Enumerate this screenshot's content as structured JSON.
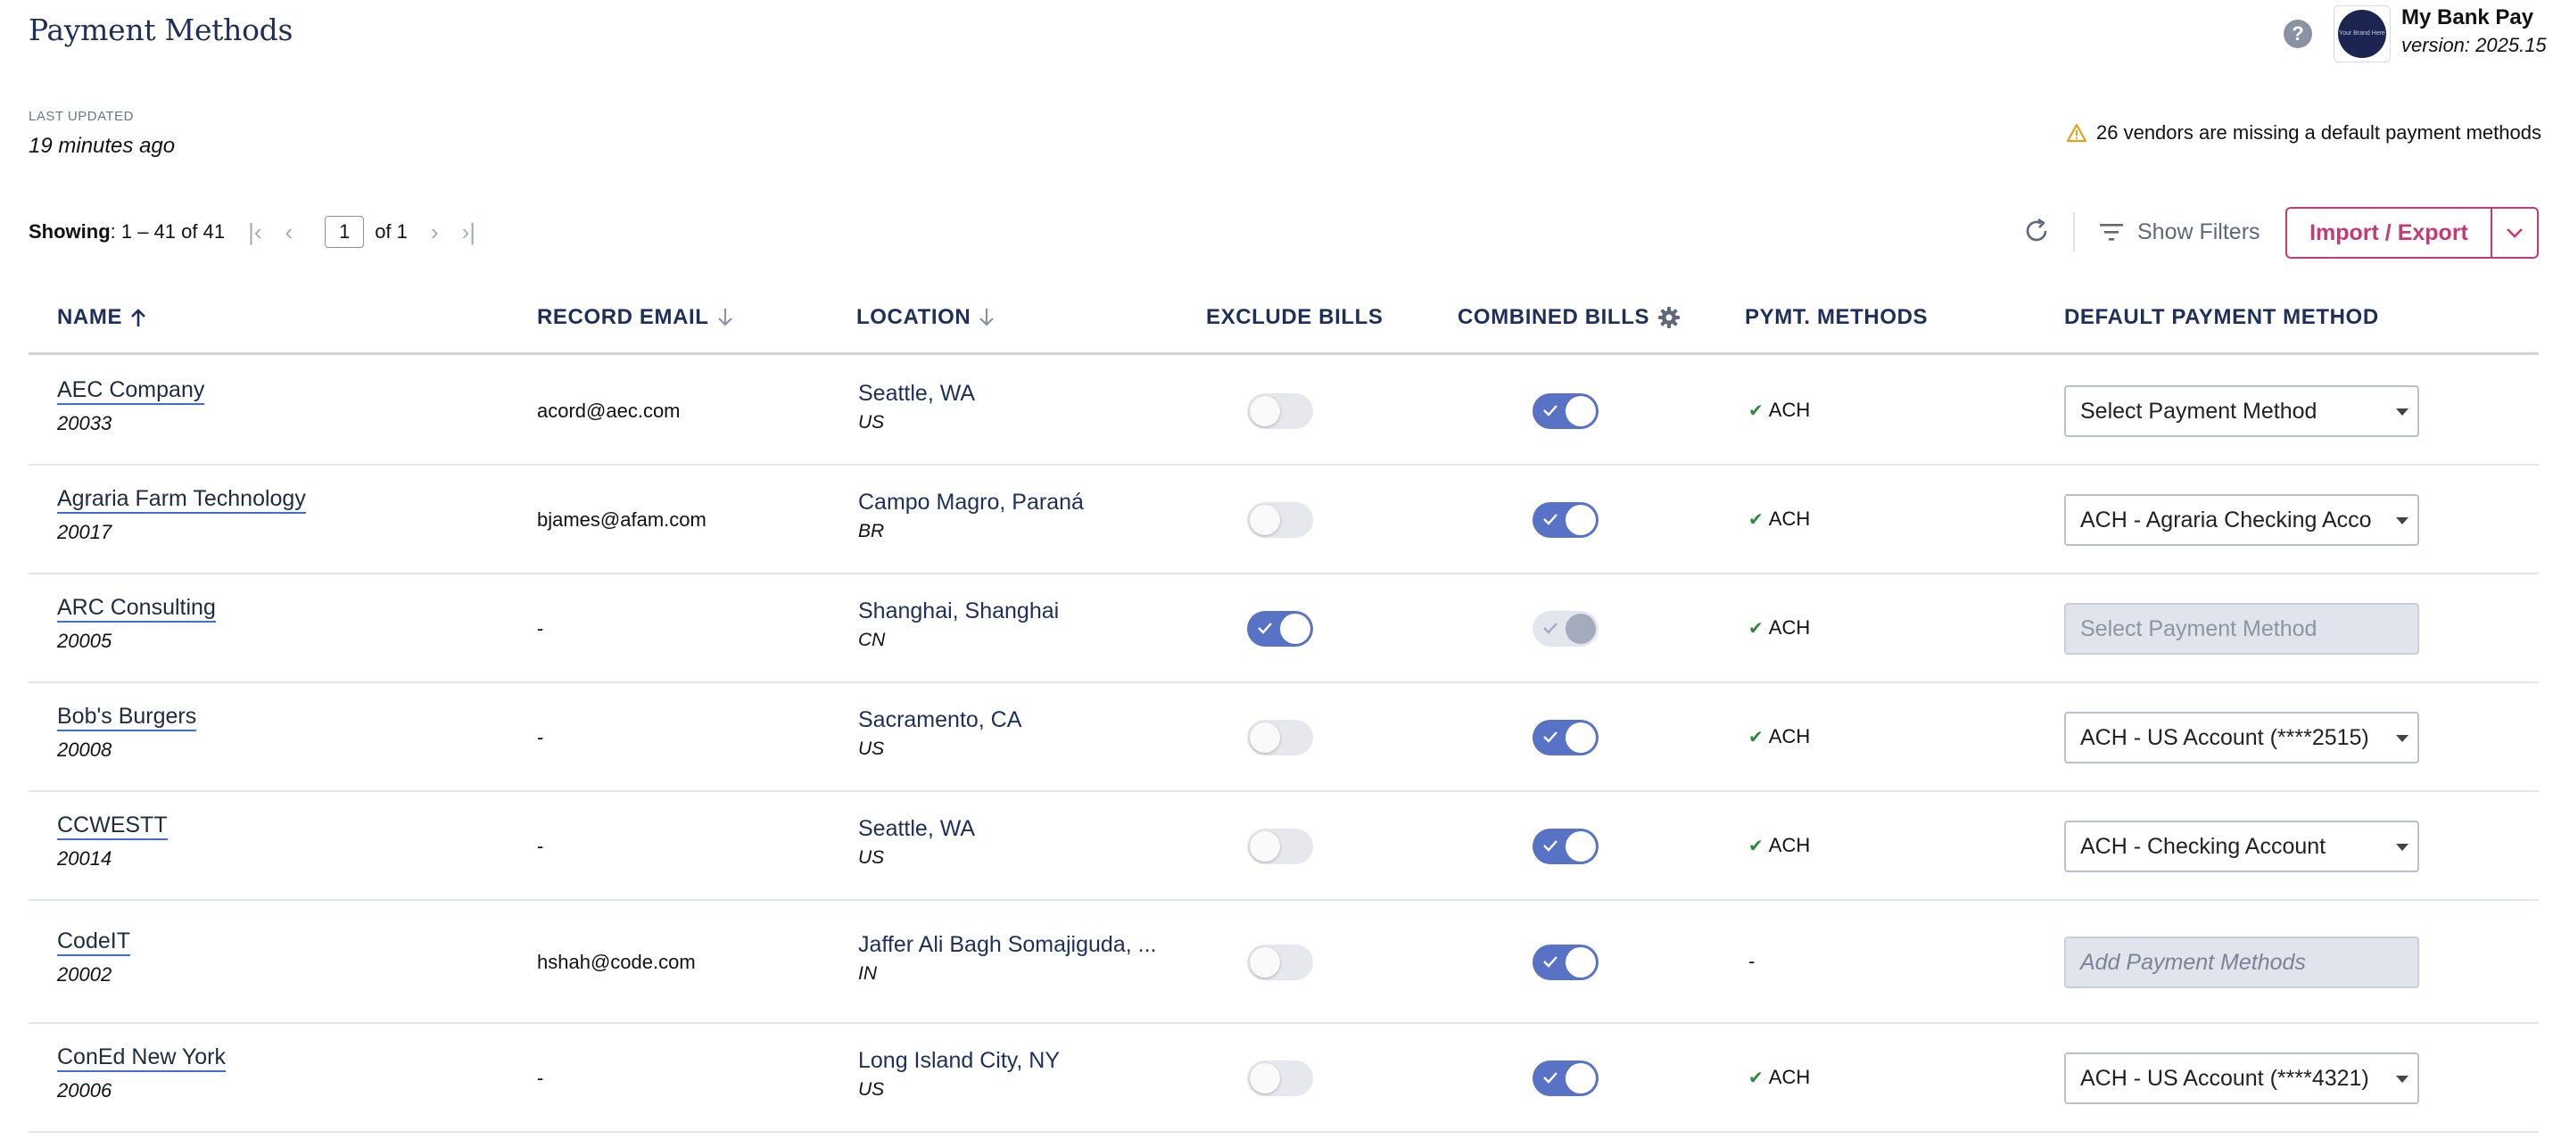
{
  "header": {
    "title": "Payment Methods",
    "app_name": "My Bank Pay",
    "app_version": "version: 2025.15",
    "logo_text": "Your Brand Here"
  },
  "status": {
    "last_updated_label": "LAST UPDATED",
    "last_updated_value": "19 minutes ago",
    "warning_text": "26 vendors are missing a default payment methods"
  },
  "pager": {
    "showing_label": "Showing",
    "showing_value": ": 1 – 41 of 41",
    "page": "1",
    "of_label": "of 1"
  },
  "toolbar": {
    "filters_label": "Show Filters",
    "import_label": "Import / Export"
  },
  "columns": {
    "name": "NAME",
    "email": "RECORD EMAIL",
    "location": "LOCATION",
    "exclude": "EXCLUDE BILLS",
    "combined": "COMBINED BILLS",
    "methods": "PYMT. METHODS",
    "default": "DEFAULT PAYMENT METHOD"
  },
  "rows": [
    {
      "name": "AEC Company",
      "id": "20033",
      "email": "acord@aec.com",
      "city": "Seattle, WA",
      "country": "US",
      "exclude": "off",
      "combined": "on",
      "methods": "ACH",
      "default": "Select Payment Method",
      "default_state": "normal"
    },
    {
      "name": "Agraria Farm Technology",
      "id": "20017",
      "email": "bjames@afam.com",
      "city": "Campo Magro, Paraná",
      "country": "BR",
      "exclude": "off",
      "combined": "on",
      "methods": "ACH",
      "default": "ACH - Agraria Checking Acco",
      "default_state": "normal"
    },
    {
      "name": "ARC Consulting",
      "id": "20005",
      "email": "-",
      "city": "Shanghai, Shanghai",
      "country": "CN",
      "exclude": "on",
      "combined": "disabled",
      "methods": "ACH",
      "default": "Select Payment Method",
      "default_state": "disabled"
    },
    {
      "name": "Bob's Burgers",
      "id": "20008",
      "email": "-",
      "city": "Sacramento, CA",
      "country": "US",
      "exclude": "off",
      "combined": "on",
      "methods": "ACH",
      "default": "ACH - US Account (****2515)",
      "default_state": "normal"
    },
    {
      "name": "CCWESTT",
      "id": "20014",
      "email": "-",
      "city": "Seattle, WA",
      "country": "US",
      "exclude": "off",
      "combined": "on",
      "methods": "ACH",
      "default": "ACH - Checking Account",
      "default_state": "normal"
    },
    {
      "name": "CodeIT",
      "id": "20002",
      "email": "hshah@code.com",
      "city": "Jaffer Ali Bagh Somajiguda, ...",
      "country": "IN",
      "exclude": "off",
      "combined": "on",
      "methods": "-",
      "default": "Add Payment Methods",
      "default_state": "add"
    },
    {
      "name": "ConEd New York",
      "id": "20006",
      "email": "-",
      "city": "Long Island City, NY",
      "country": "US",
      "exclude": "off",
      "combined": "on",
      "methods": "ACH",
      "default": "ACH - US Account (****4321)",
      "default_state": "normal"
    }
  ],
  "colors": {
    "title": "#1d2f5a",
    "accent": "#c23b78",
    "toggle_on": "#5872c6",
    "check_green": "#2d8a3a"
  },
  "icons": [
    "help-icon",
    "warning-icon",
    "first-page-icon",
    "prev-page-icon",
    "next-page-icon",
    "last-page-icon",
    "refresh-icon",
    "filter-icon",
    "chevron-down-icon",
    "sort-asc-icon",
    "sort-desc-icon",
    "gear-icon",
    "checkmark-icon"
  ]
}
